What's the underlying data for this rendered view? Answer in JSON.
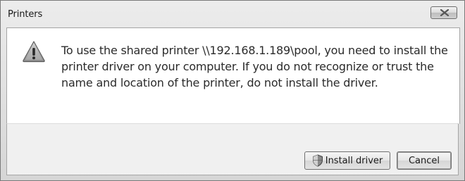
{
  "window": {
    "title": "Printers"
  },
  "dialog": {
    "message": "To use the shared printer \\\\192.168.1.189\\pool, you need to install the printer driver on your computer.  If you do not recognize or trust the name and location of the printer, do not install the driver.",
    "icon": "warning-icon"
  },
  "buttons": {
    "install_label": "Install driver",
    "install_icon": "shield-icon",
    "cancel_label": "Cancel"
  },
  "colors": {
    "content_bg": "#ffffff",
    "button_bar_bg": "#f0f0f0",
    "text": "#2b2b2b"
  }
}
